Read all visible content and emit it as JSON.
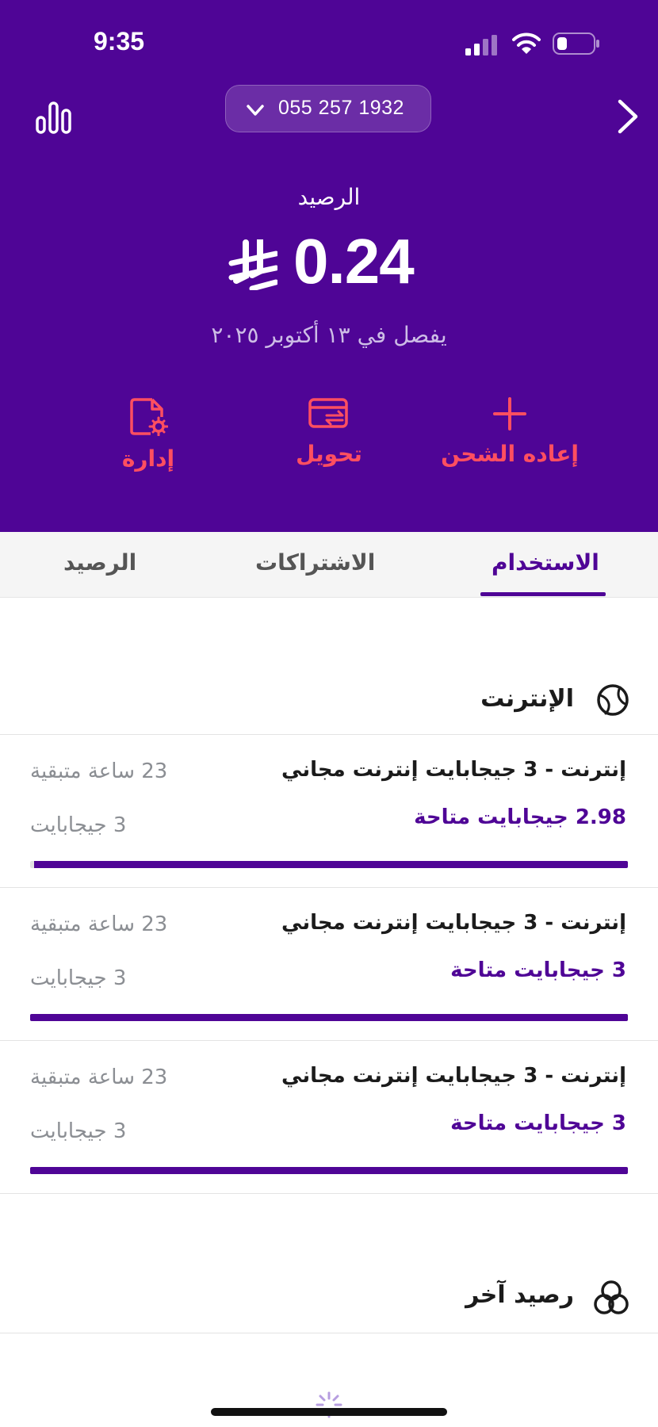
{
  "status_bar": {
    "time": "9:35"
  },
  "header": {
    "phone_number": "055 257 1932",
    "balance_label": "الرصيد",
    "balance_amount": "0.24",
    "expiry_text": "يفصل في ١٣ أكتوبر ٢٠٢٥",
    "actions": [
      {
        "label": "إعاده الشحن",
        "icon": "plus-icon"
      },
      {
        "label": "تحويل",
        "icon": "card-transfer-icon"
      },
      {
        "label": "إدارة",
        "icon": "file-settings-icon"
      }
    ]
  },
  "tabs": [
    {
      "label": "الاستخدام",
      "active": true
    },
    {
      "label": "الاشتراكات",
      "active": false
    },
    {
      "label": "الرصيد",
      "active": false
    }
  ],
  "internet_section": {
    "title": "الإنترنت",
    "icon": "globe-icon",
    "items": [
      {
        "name": "إنترنت - 3 جيجابايت إنترنت مجاني",
        "available": "2.98 جيجابايت متاحة",
        "remaining": "23 ساعة متبقية",
        "total": "3 جيجابايت",
        "fraction": 0.993
      },
      {
        "name": "إنترنت - 3 جيجابايت إنترنت مجاني",
        "available": "3 جيجابايت متاحة",
        "remaining": "23 ساعة متبقية",
        "total": "3 جيجابايت",
        "fraction": 1.0
      },
      {
        "name": "إنترنت - 3 جيجابايت إنترنت مجاني",
        "available": "3 جيجابايت متاحة",
        "remaining": "23 ساعة متبقية",
        "total": "3 جيجابايت",
        "fraction": 1.0
      }
    ]
  },
  "other_section": {
    "title": "رصيد آخر",
    "icon": "circles-icon"
  },
  "colors": {
    "brand_purple": "#4f0596",
    "action_red": "#ff4f60",
    "muted_gray": "#8b8e93"
  }
}
